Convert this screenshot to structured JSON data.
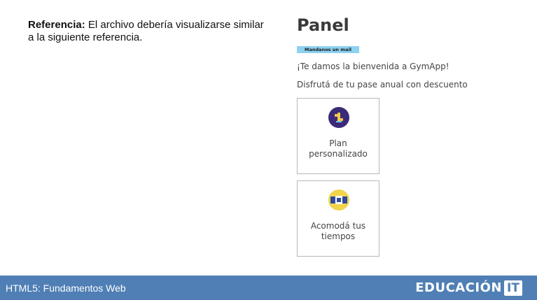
{
  "reference": {
    "label": "Referencia:",
    "text": "El archivo debería visualizarse similar a la siguiente referencia."
  },
  "panel": {
    "title": "Panel",
    "badge": "Mandanos un mail",
    "welcome": "¡Te damos la bienvenida a GymApp!",
    "promo": "Disfrutá de tu pase anual con descuento"
  },
  "cards": [
    {
      "label": "Plan personalizado",
      "icon": "dumbbell-icon"
    },
    {
      "label": "Acomodá tus tiempos",
      "icon": "calendar-icon"
    }
  ],
  "footer": {
    "course": "HTML5: Fundamentos Web",
    "brand_word": "EDUCACIÓN",
    "brand_box": "IT"
  },
  "colors": {
    "footer_bg": "#4f7fb5",
    "badge_bg": "#8dd1f0",
    "icon1_bg": "#3b2a78",
    "icon1_fg": "#f2c94c",
    "icon2_bg": "#f2d34c",
    "icon2_fg": "#2d4aa0"
  }
}
